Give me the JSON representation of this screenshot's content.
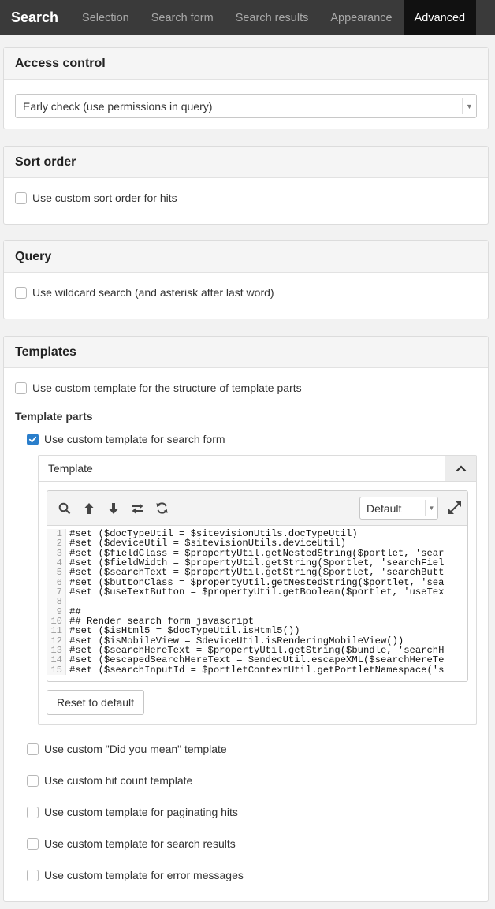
{
  "tabs": [
    {
      "label": "Search"
    },
    {
      "label": "Selection"
    },
    {
      "label": "Search form"
    },
    {
      "label": "Search results"
    },
    {
      "label": "Appearance"
    },
    {
      "label": "Advanced"
    }
  ],
  "access_control": {
    "title": "Access control",
    "select_value": "Early check (use permissions in query)"
  },
  "sort_order": {
    "title": "Sort order",
    "checkbox_label": "Use custom sort order for hits",
    "checked": false
  },
  "query": {
    "title": "Query",
    "checkbox_label": "Use wildcard search (and asterisk after last word)",
    "checked": false
  },
  "templates": {
    "title": "Templates",
    "structure_label": "Use custom template for the structure of template parts",
    "parts_heading": "Template parts",
    "search_form_label": "Use custom template for search form",
    "search_form_checked": true,
    "template_box_label": "Template",
    "editor_mode": "Default",
    "reset_label": "Reset to default",
    "code_lines": [
      "#set ($docTypeUtil = $sitevisionUtils.docTypeUtil)",
      "#set ($deviceUtil = $sitevisionUtils.deviceUtil)",
      "#set ($fieldClass = $propertyUtil.getNestedString($portlet, 'sear",
      "#set ($fieldWidth = $propertyUtil.getString($portlet, 'searchFiel",
      "#set ($searchText = $propertyUtil.getString($portlet, 'searchButt",
      "#set ($buttonClass = $propertyUtil.getNestedString($portlet, 'sea",
      "#set ($useTextButton = $propertyUtil.getBoolean($portlet, 'useTex",
      "",
      "##",
      "## Render search form javascript",
      "#set ($isHtml5 = $docTypeUtil.isHtml5())",
      "#set ($isMobileView = $deviceUtil.isRenderingMobileView())",
      "#set ($searchHereText = $propertyUtil.getString($bundle, 'searchH",
      "#set ($escapedSearchHereText = $endecUtil.escapeXML($searchHereTe",
      "#set ($searchInputId = $portletContextUtil.getPortletNamespace('s"
    ],
    "other_options": [
      "Use custom \"Did you mean\" template",
      "Use custom hit count template",
      "Use custom template for paginating hits",
      "Use custom template for search results",
      "Use custom template for error messages"
    ]
  }
}
